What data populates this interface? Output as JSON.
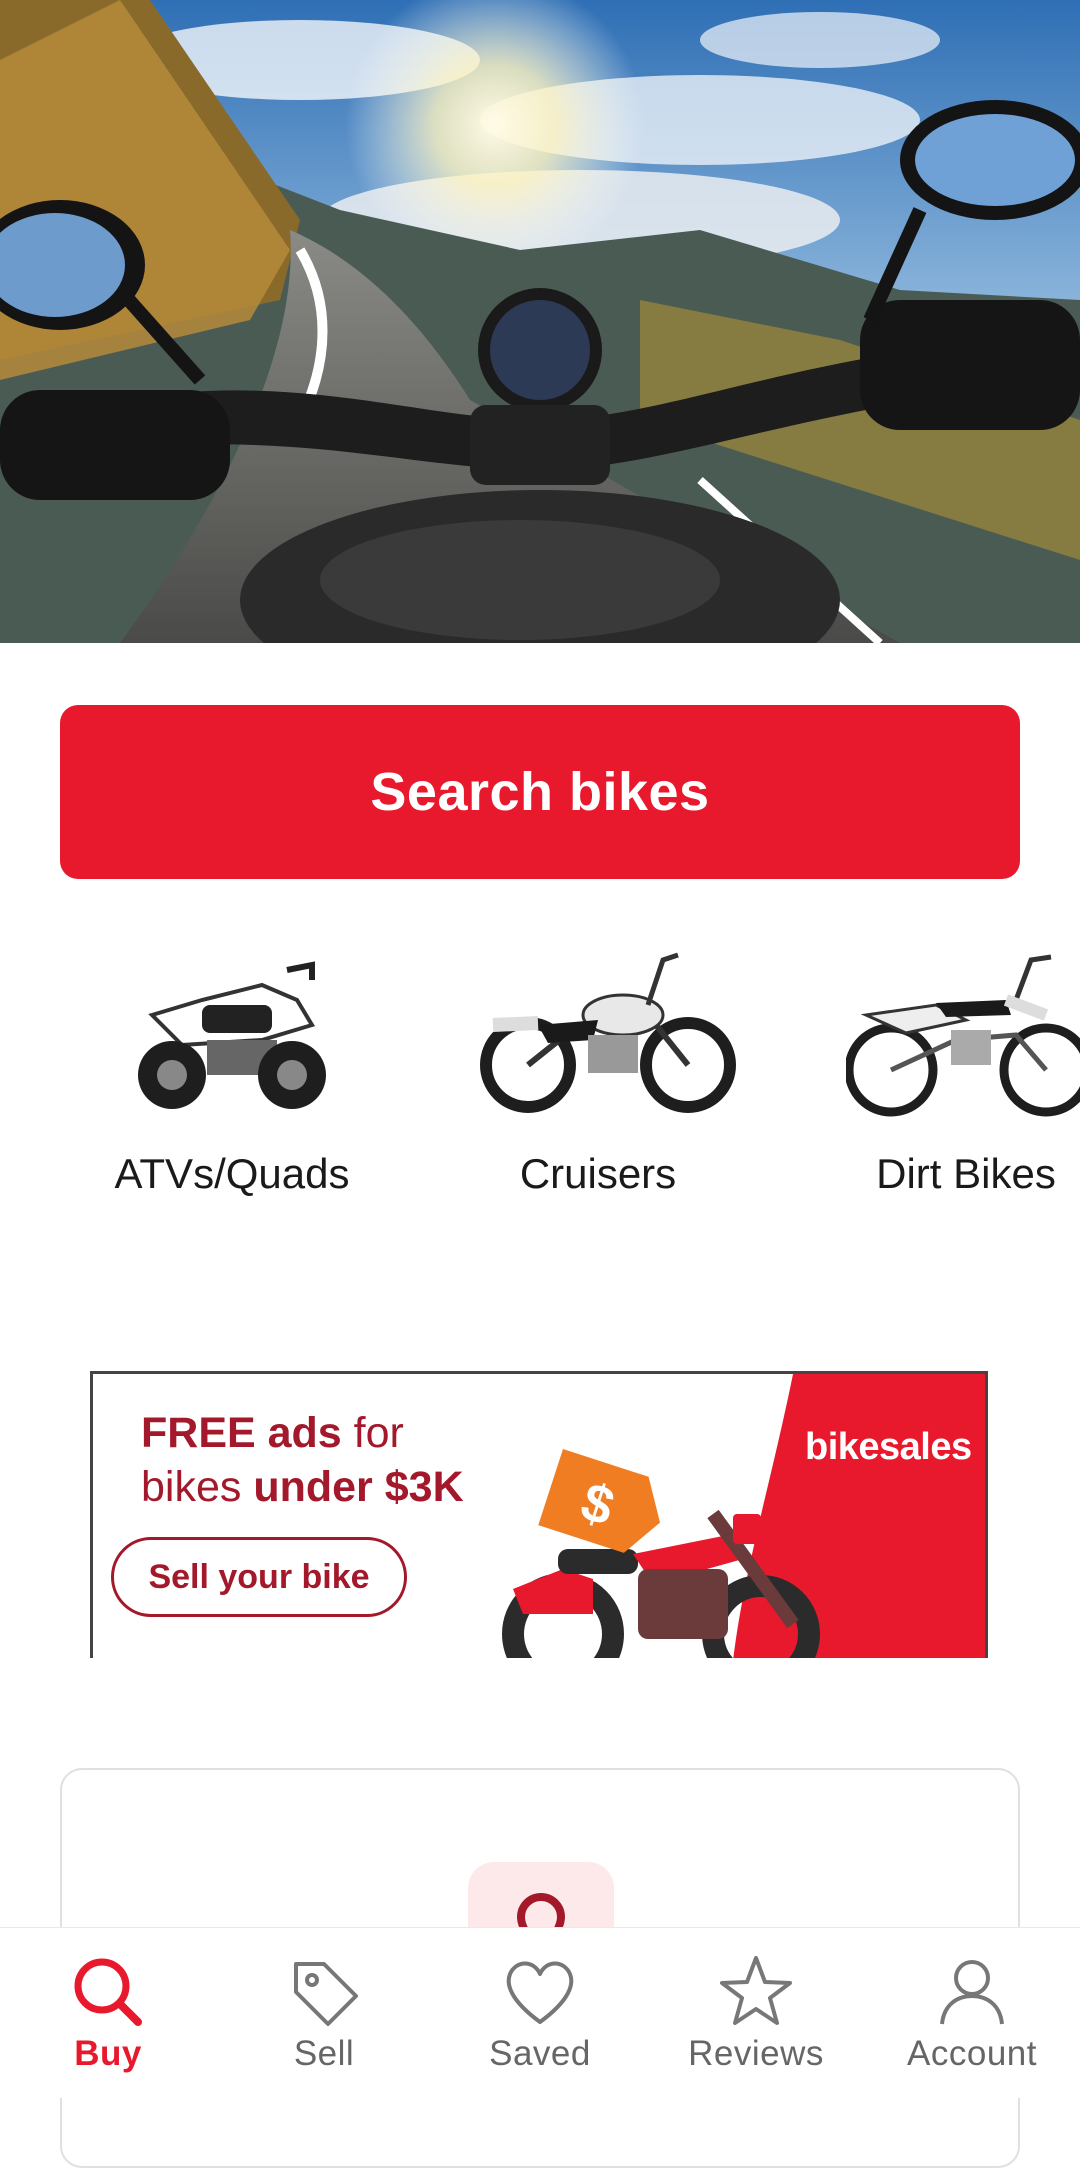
{
  "hero": {
    "icon": "motorcycle-road-photo"
  },
  "search": {
    "label": "Search bikes"
  },
  "categories": [
    {
      "label": "ATVs/Quads",
      "icon": "atv-image"
    },
    {
      "label": "Cruisers",
      "icon": "cruiser-image"
    },
    {
      "label": "Dirt Bikes",
      "icon": "dirt-bike-image"
    }
  ],
  "banner": {
    "line1_bold": "FREE ads",
    "line1_rest": " for",
    "line2_start": "bikes ",
    "line2_bold": "under $3K",
    "cta": "Sell your bike",
    "brand": "bikesales",
    "colors": {
      "accent": "#e8192c",
      "text": "#a3182a",
      "tag": "#f07d22"
    }
  },
  "nav": {
    "items": [
      {
        "label": "Buy",
        "icon": "search-icon",
        "active": true
      },
      {
        "label": "Sell",
        "icon": "tag-icon",
        "active": false
      },
      {
        "label": "Saved",
        "icon": "heart-icon",
        "active": false
      },
      {
        "label": "Reviews",
        "icon": "star-icon",
        "active": false
      },
      {
        "label": "Account",
        "icon": "user-icon",
        "active": false
      }
    ]
  },
  "colors": {
    "primary": "#e8192c"
  }
}
